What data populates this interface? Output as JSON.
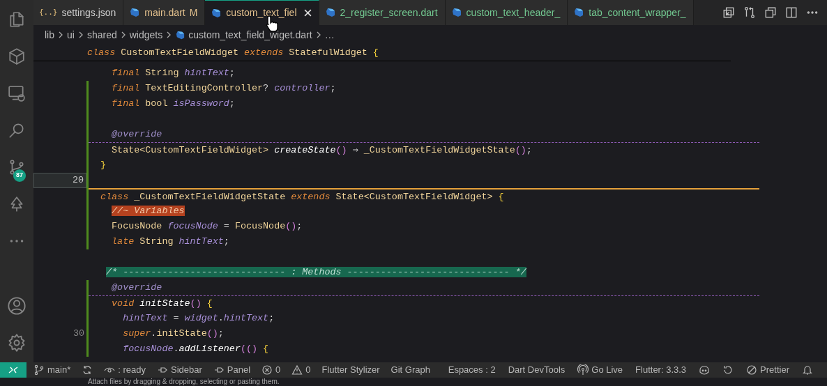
{
  "activity_bar": {
    "top": [
      {
        "kind": "files",
        "selected": false
      },
      {
        "kind": "cube",
        "selected": false
      },
      {
        "kind": "remote",
        "selected": false
      },
      {
        "kind": "search",
        "selected": false
      },
      {
        "kind": "branch",
        "selected": false,
        "badge": "87"
      },
      {
        "kind": "tree",
        "selected": false
      },
      {
        "kind": "more",
        "selected": false
      }
    ],
    "bottom": [
      {
        "kind": "account"
      },
      {
        "kind": "settings"
      }
    ]
  },
  "tabs": [
    {
      "kind": "json",
      "icon_text": "{..}",
      "label": "settings.json",
      "color": "#cccccc",
      "selected": false
    },
    {
      "kind": "dart",
      "label": "main.dart",
      "badge": "M",
      "color": "#e2c08d",
      "selected": false
    },
    {
      "kind": "dart",
      "label": "custom_text_fiel",
      "color": "#e2c08d",
      "selected": true
    },
    {
      "kind": "dart",
      "label": "2_register_screen.dart",
      "color": "#73c991",
      "selected": false
    },
    {
      "kind": "dart",
      "label": "custom_text_header_",
      "color": "#73c991",
      "selected": false
    },
    {
      "kind": "dart",
      "label": "tab_content_wrapper_",
      "color": "#73c991",
      "selected": false
    }
  ],
  "breadcrumb": [
    {
      "kind": "folder",
      "label": "lib"
    },
    {
      "kind": "folder",
      "label": "ui"
    },
    {
      "kind": "folder",
      "label": "shared"
    },
    {
      "kind": "folder",
      "label": "widgets"
    },
    {
      "kind": "file",
      "label": "custom_text_field_wiget.dart"
    },
    {
      "kind": "folder",
      "label": "…"
    }
  ],
  "sticky_line": [
    {
      "kind": "kw",
      "text": "class "
    },
    {
      "kind": "type",
      "text": "CustomTextFieldWidget "
    },
    {
      "kind": "kw",
      "text": "extends "
    },
    {
      "kind": "type",
      "text": "StatefulWidget "
    },
    {
      "kind": "brace",
      "text": "{"
    }
  ],
  "lines": [
    {
      "changed": false,
      "tokens": [
        {
          "kind": "kw",
          "text": "  final "
        },
        {
          "kind": "type",
          "text": "String "
        },
        {
          "kind": "var",
          "text": "hintText"
        },
        {
          "kind": "p",
          "text": ";"
        }
      ]
    },
    {
      "changed": true,
      "tokens": [
        {
          "kind": "kw",
          "text": "  final "
        },
        {
          "kind": "type",
          "text": "TextEditingController"
        },
        {
          "kind": "p",
          "text": "? "
        },
        {
          "kind": "var",
          "text": "controller"
        },
        {
          "kind": "p",
          "text": ";"
        }
      ]
    },
    {
      "changed": true,
      "tokens": [
        {
          "kind": "kw",
          "text": "  final "
        },
        {
          "kind": "type",
          "text": "bool "
        },
        {
          "kind": "var",
          "text": "isPassword"
        },
        {
          "kind": "p",
          "text": ";"
        }
      ]
    },
    {
      "changed": true
    },
    {
      "changed": true,
      "tokens": [
        {
          "kind": "anno",
          "text": "  @override"
        }
      ]
    },
    {
      "changed": true,
      "kind": "dashed",
      "tokens": [
        {
          "kind": "type",
          "text": "  State<CustomTextFieldWidget> "
        },
        {
          "kind": "fn",
          "text": "createState"
        },
        {
          "kind": "paren",
          "text": "()"
        },
        {
          "kind": "p",
          "text": " ⇒ "
        },
        {
          "kind": "type",
          "text": "_CustomTextFieldWidgetState"
        },
        {
          "kind": "paren",
          "text": "()"
        },
        {
          "kind": "p",
          "text": ";"
        }
      ]
    },
    {
      "changed": true,
      "tokens": [
        {
          "kind": "brace",
          "text": "}"
        }
      ]
    },
    {
      "changed": true,
      "number": "20",
      "current": true
    },
    {
      "changed": true,
      "kind": "solid",
      "tokens": [
        {
          "kind": "kw",
          "text": "class "
        },
        {
          "kind": "type",
          "text": "_CustomTextFieldWidgetState "
        },
        {
          "kind": "kw",
          "text": "extends "
        },
        {
          "kind": "type",
          "text": "State<CustomTextFieldWidget> "
        },
        {
          "kind": "brace",
          "text": "{"
        }
      ]
    },
    {
      "changed": true,
      "tokens": [
        {
          "kind": "hl_orange",
          "text": "  //~ Variables"
        }
      ]
    },
    {
      "changed": true,
      "tokens": [
        {
          "kind": "type",
          "text": "  FocusNode "
        },
        {
          "kind": "var",
          "text": "focusNode"
        },
        {
          "kind": "p",
          "text": " = "
        },
        {
          "kind": "type",
          "text": "FocusNode"
        },
        {
          "kind": "paren",
          "text": "()"
        },
        {
          "kind": "p",
          "text": ";"
        }
      ]
    },
    {
      "changed": true,
      "tokens": [
        {
          "kind": "kw",
          "text": "  late "
        },
        {
          "kind": "type",
          "text": "String "
        },
        {
          "kind": "var",
          "text": "hintText"
        },
        {
          "kind": "p",
          "text": ";"
        }
      ]
    },
    {
      "changed": false
    },
    {
      "changed": false,
      "tokens": [
        {
          "kind": "hl_green",
          "text": " /* ----------------------------- : Methods ----------------------------- */"
        }
      ]
    },
    {
      "changed": true,
      "tokens": [
        {
          "kind": "anno",
          "text": "  @override"
        }
      ]
    },
    {
      "changed": true,
      "kind": "dashed",
      "tokens": [
        {
          "kind": "kw",
          "text": "  void "
        },
        {
          "kind": "fn",
          "text": "initState"
        },
        {
          "kind": "paren",
          "text": "()"
        },
        {
          "kind": "brace",
          "text": " {"
        }
      ]
    },
    {
      "changed": true,
      "tokens": [
        {
          "kind": "var",
          "text": "    hintText"
        },
        {
          "kind": "p",
          "text": " = "
        },
        {
          "kind": "var",
          "text": "widget"
        },
        {
          "kind": "p",
          "text": "."
        },
        {
          "kind": "var",
          "text": "hintText"
        },
        {
          "kind": "p",
          "text": ";"
        }
      ]
    },
    {
      "changed": true,
      "number": "30",
      "tokens": [
        {
          "kind": "kw",
          "text": "    super"
        },
        {
          "kind": "p",
          "text": "."
        },
        {
          "kind": "type",
          "text": "initState"
        },
        {
          "kind": "paren",
          "text": "()"
        },
        {
          "kind": "p",
          "text": ";"
        }
      ]
    },
    {
      "changed": true,
      "tokens": [
        {
          "kind": "var",
          "text": "    focusNode"
        },
        {
          "kind": "p",
          "text": "."
        },
        {
          "kind": "fn",
          "text": "addListener"
        },
        {
          "kind": "paren",
          "text": "(() "
        },
        {
          "kind": "brace",
          "text": "{"
        }
      ]
    }
  ],
  "status_bar": {
    "left": [
      {
        "kind": "branch",
        "label": "main*"
      },
      {
        "kind": "sync"
      },
      {
        "kind": "eye",
        "label": ": ready"
      },
      {
        "kind": "pin",
        "label": "Sidebar"
      },
      {
        "kind": "pin",
        "label": "Panel"
      },
      {
        "kind": "error",
        "label": "0"
      },
      {
        "kind": "warning",
        "label": "0"
      },
      {
        "kind": "text",
        "label": "Flutter Stylizer"
      },
      {
        "kind": "text",
        "label": "Git Graph"
      }
    ],
    "right": [
      {
        "kind": "text",
        "label": "Espaces : 2"
      },
      {
        "kind": "text",
        "label": "Dart DevTools"
      },
      {
        "kind": "broadcast",
        "label": "Go Live"
      },
      {
        "kind": "text",
        "label": "Flutter: 3.3.3"
      },
      {
        "kind": "copilot"
      },
      {
        "kind": "history"
      },
      {
        "kind": "blocked",
        "label": "Prettier"
      },
      {
        "kind": "bell"
      }
    ]
  },
  "bottom_panel": {
    "text": "Attach files by dragging & dropping, selecting or pasting them."
  }
}
